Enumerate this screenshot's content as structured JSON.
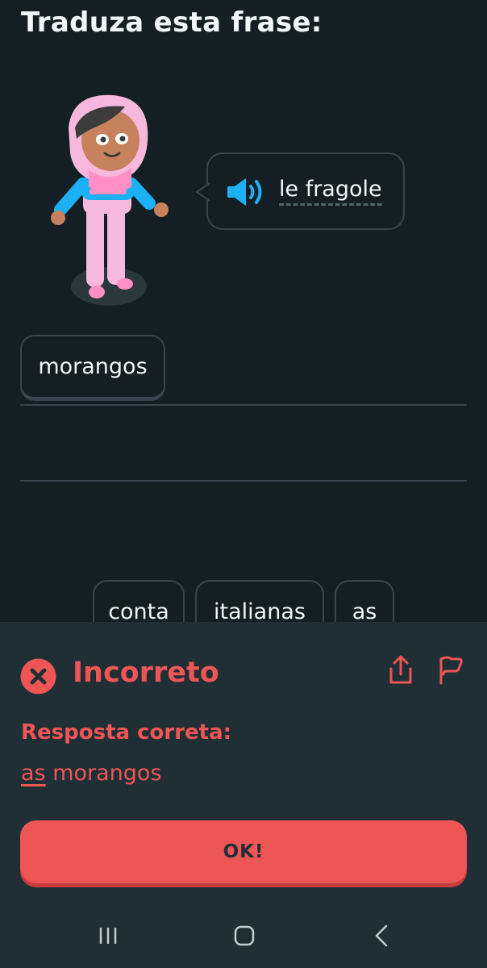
{
  "exercise": {
    "prompt": "Traduza esta frase:",
    "source_phrase": "le fragole"
  },
  "answer": {
    "selected_words": [
      "morangos"
    ]
  },
  "word_bank": [
    "conta",
    "italianas",
    "as"
  ],
  "feedback": {
    "status": "Incorreto",
    "correct_answer_label": "Resposta correta:",
    "correct_answer_highlight": "as",
    "correct_answer_rest": " morangos",
    "ok_button": "OK!"
  },
  "icons": {
    "speaker": "speaker-icon",
    "incorrect": "x-circle-icon",
    "share": "share-icon",
    "report": "flag-icon",
    "nav_recents": "recents-icon",
    "nav_home": "home-icon",
    "nav_back": "back-icon"
  },
  "colors": {
    "background": "#131f24",
    "panel": "#202f36",
    "error_red": "#ee5555",
    "speaker_blue": "#1cb0f6",
    "border": "#37464f"
  }
}
